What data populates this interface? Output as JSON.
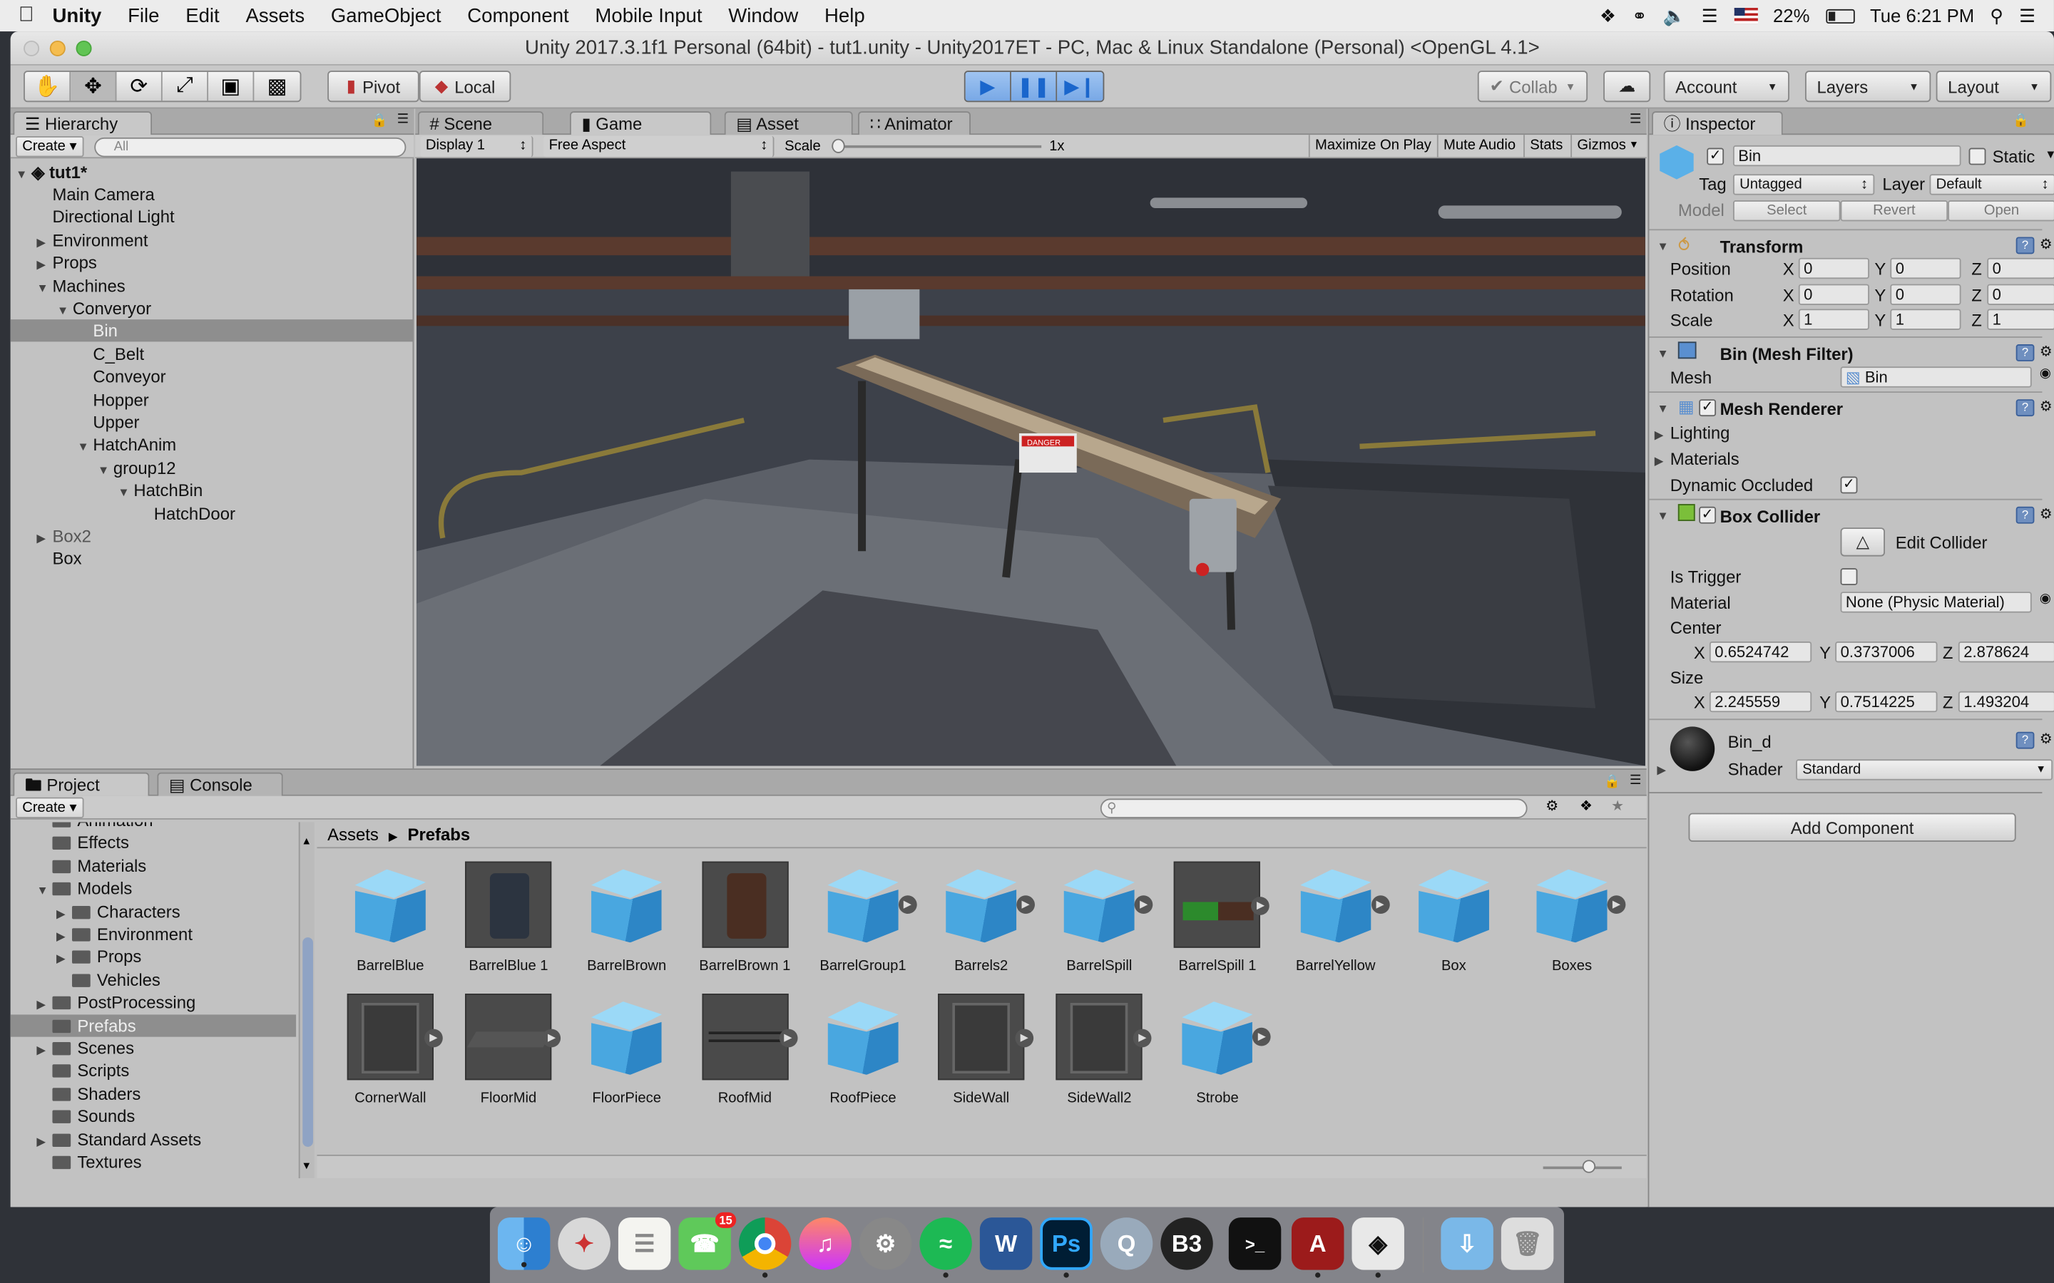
{
  "menubar": {
    "app": "Unity",
    "items": [
      "File",
      "Edit",
      "Assets",
      "GameObject",
      "Component",
      "Mobile Input",
      "Window",
      "Help"
    ],
    "battery": "22%",
    "clock": "Tue 6:21 PM"
  },
  "window": {
    "title": "Unity 2017.3.1f1 Personal (64bit) - tut1.unity - Unity2017ET - PC, Mac & Linux Standalone (Personal) <OpenGL 4.1>"
  },
  "toolbar": {
    "pivot": "Pivot",
    "local": "Local",
    "collab": "Collab",
    "account": "Account",
    "layers": "Layers",
    "layout": "Layout"
  },
  "hierarchy": {
    "tab": "Hierarchy",
    "create": "Create",
    "search": "All",
    "scene": "tut1*",
    "items": [
      {
        "label": "Main Camera",
        "depth": 0,
        "arrow": ""
      },
      {
        "label": "Directional Light",
        "depth": 0,
        "arrow": ""
      },
      {
        "label": "Environment",
        "depth": 0,
        "arrow": "right"
      },
      {
        "label": "Props",
        "depth": 0,
        "arrow": "right"
      },
      {
        "label": "Machines",
        "depth": 0,
        "arrow": "down"
      },
      {
        "label": "Converyor",
        "depth": 1,
        "arrow": "down"
      },
      {
        "label": "Bin",
        "depth": 2,
        "arrow": "",
        "selected": true
      },
      {
        "label": "C_Belt",
        "depth": 2,
        "arrow": ""
      },
      {
        "label": "Conveyor",
        "depth": 2,
        "arrow": ""
      },
      {
        "label": "Hopper",
        "depth": 2,
        "arrow": ""
      },
      {
        "label": "Upper",
        "depth": 2,
        "arrow": ""
      },
      {
        "label": "HatchAnim",
        "depth": 2,
        "arrow": "down"
      },
      {
        "label": "group12",
        "depth": 3,
        "arrow": "down"
      },
      {
        "label": "HatchBin",
        "depth": 4,
        "arrow": "down"
      },
      {
        "label": "HatchDoor",
        "depth": 5,
        "arrow": ""
      },
      {
        "label": "Box2",
        "depth": 0,
        "arrow": "right",
        "gray": true
      },
      {
        "label": "Box",
        "depth": 0,
        "arrow": ""
      }
    ]
  },
  "viewtabs": {
    "scene": "Scene",
    "game": "Game",
    "store": "Asset Store",
    "animator": "Animator"
  },
  "gamebar": {
    "display": "Display 1",
    "aspect": "Free Aspect",
    "scale_label": "Scale",
    "scale_value": "1x",
    "maximize": "Maximize On Play",
    "mute": "Mute Audio",
    "stats": "Stats",
    "gizmos": "Gizmos"
  },
  "game": {
    "sign": "DANGER"
  },
  "inspector": {
    "tab": "Inspector",
    "name": "Bin",
    "static": "Static",
    "tag_label": "Tag",
    "tag": "Untagged",
    "layer_label": "Layer",
    "layer": "Default",
    "model_label": "Model",
    "select": "Select",
    "revert": "Revert",
    "open": "Open",
    "transform": {
      "title": "Transform",
      "rows": [
        {
          "label": "Position",
          "x": "0",
          "y": "0",
          "z": "0"
        },
        {
          "label": "Rotation",
          "x": "0",
          "y": "0",
          "z": "0"
        },
        {
          "label": "Scale",
          "x": "1",
          "y": "1",
          "z": "1"
        }
      ]
    },
    "meshfilter": {
      "title": "Bin (Mesh Filter)",
      "mesh_label": "Mesh",
      "mesh": "Bin"
    },
    "meshrenderer": {
      "title": "Mesh Renderer",
      "lighting": "Lighting",
      "materials": "Materials",
      "occluded": "Dynamic Occluded"
    },
    "collider": {
      "title": "Box Collider",
      "edit": "Edit Collider",
      "trigger": "Is Trigger",
      "material_label": "Material",
      "material": "None (Physic Material)",
      "center": "Center",
      "cx": "0.6524742",
      "cy": "0.3737006",
      "cz": "2.878624",
      "size": "Size",
      "sx": "2.245559",
      "sy": "0.7514225",
      "sz": "1.493204"
    },
    "mat": {
      "name": "Bin_d",
      "shader_label": "Shader",
      "shader": "Standard"
    },
    "add": "Add Component"
  },
  "axis": {
    "x": "X",
    "y": "Y",
    "z": "Z"
  },
  "project": {
    "tab": "Project",
    "console": "Console",
    "create": "Create",
    "crumb1": "Assets",
    "crumb2": "Prefabs",
    "tree": [
      {
        "label": "Animation",
        "depth": 1,
        "arrow": ""
      },
      {
        "label": "Effects",
        "depth": 1,
        "arrow": ""
      },
      {
        "label": "Materials",
        "depth": 1,
        "arrow": ""
      },
      {
        "label": "Models",
        "depth": 1,
        "arrow": "down"
      },
      {
        "label": "Characters",
        "depth": 2,
        "arrow": "right"
      },
      {
        "label": "Environment",
        "depth": 2,
        "arrow": "right"
      },
      {
        "label": "Props",
        "depth": 2,
        "arrow": "right"
      },
      {
        "label": "Vehicles",
        "depth": 2,
        "arrow": ""
      },
      {
        "label": "PostProcessing",
        "depth": 1,
        "arrow": "right"
      },
      {
        "label": "Prefabs",
        "depth": 1,
        "arrow": "",
        "selected": true
      },
      {
        "label": "Scenes",
        "depth": 1,
        "arrow": "right"
      },
      {
        "label": "Scripts",
        "depth": 1,
        "arrow": ""
      },
      {
        "label": "Shaders",
        "depth": 1,
        "arrow": ""
      },
      {
        "label": "Sounds",
        "depth": 1,
        "arrow": ""
      },
      {
        "label": "Standard Assets",
        "depth": 1,
        "arrow": "right"
      },
      {
        "label": "Textures",
        "depth": 1,
        "arrow": ""
      }
    ],
    "assets": [
      {
        "label": "BarrelBlue",
        "kind": "cube",
        "arrow": false
      },
      {
        "label": "BarrelBlue 1",
        "kind": "barrelblue",
        "arrow": false
      },
      {
        "label": "BarrelBrown",
        "kind": "cube",
        "arrow": false
      },
      {
        "label": "BarrelBrown 1",
        "kind": "barrelbrown",
        "arrow": false
      },
      {
        "label": "BarrelGroup1",
        "kind": "cube",
        "arrow": true
      },
      {
        "label": "Barrels2",
        "kind": "cube",
        "arrow": true
      },
      {
        "label": "BarrelSpill",
        "kind": "cube",
        "arrow": true
      },
      {
        "label": "BarrelSpill 1",
        "kind": "spill",
        "arrow": true
      },
      {
        "label": "BarrelYellow",
        "kind": "cube",
        "arrow": true
      },
      {
        "label": "Box",
        "kind": "cube",
        "arrow": false
      },
      {
        "label": "Boxes",
        "kind": "cube",
        "arrow": true
      },
      {
        "label": "CornerWall",
        "kind": "wall",
        "arrow": true
      },
      {
        "label": "FloorMid",
        "kind": "floor",
        "arrow": true
      },
      {
        "label": "FloorPiece",
        "kind": "cube",
        "arrow": false
      },
      {
        "label": "RoofMid",
        "kind": "roof",
        "arrow": true
      },
      {
        "label": "RoofPiece",
        "kind": "cube",
        "arrow": false
      },
      {
        "label": "SideWall",
        "kind": "wall",
        "arrow": true
      },
      {
        "label": "SideWall2",
        "kind": "wall",
        "arrow": true
      },
      {
        "label": "Strobe",
        "kind": "cube",
        "arrow": true
      }
    ]
  },
  "dock": {
    "badge": "15",
    "apps": [
      "finder-icon",
      "safari-icon",
      "notes-icon",
      "facetime-icon",
      "chrome-icon",
      "itunes-icon",
      "system-preferences-icon",
      "spotify-icon",
      "word-icon",
      "photoshop-icon",
      "quicktime-icon",
      "b3-icon",
      "terminal-icon",
      "acrobat-icon",
      "unity-icon",
      "downloads-folder-icon",
      "trash-icon"
    ],
    "labels": {
      "word": "W",
      "ps": "Ps",
      "b3": "B3",
      "term": ">_",
      "acro": "A"
    }
  }
}
